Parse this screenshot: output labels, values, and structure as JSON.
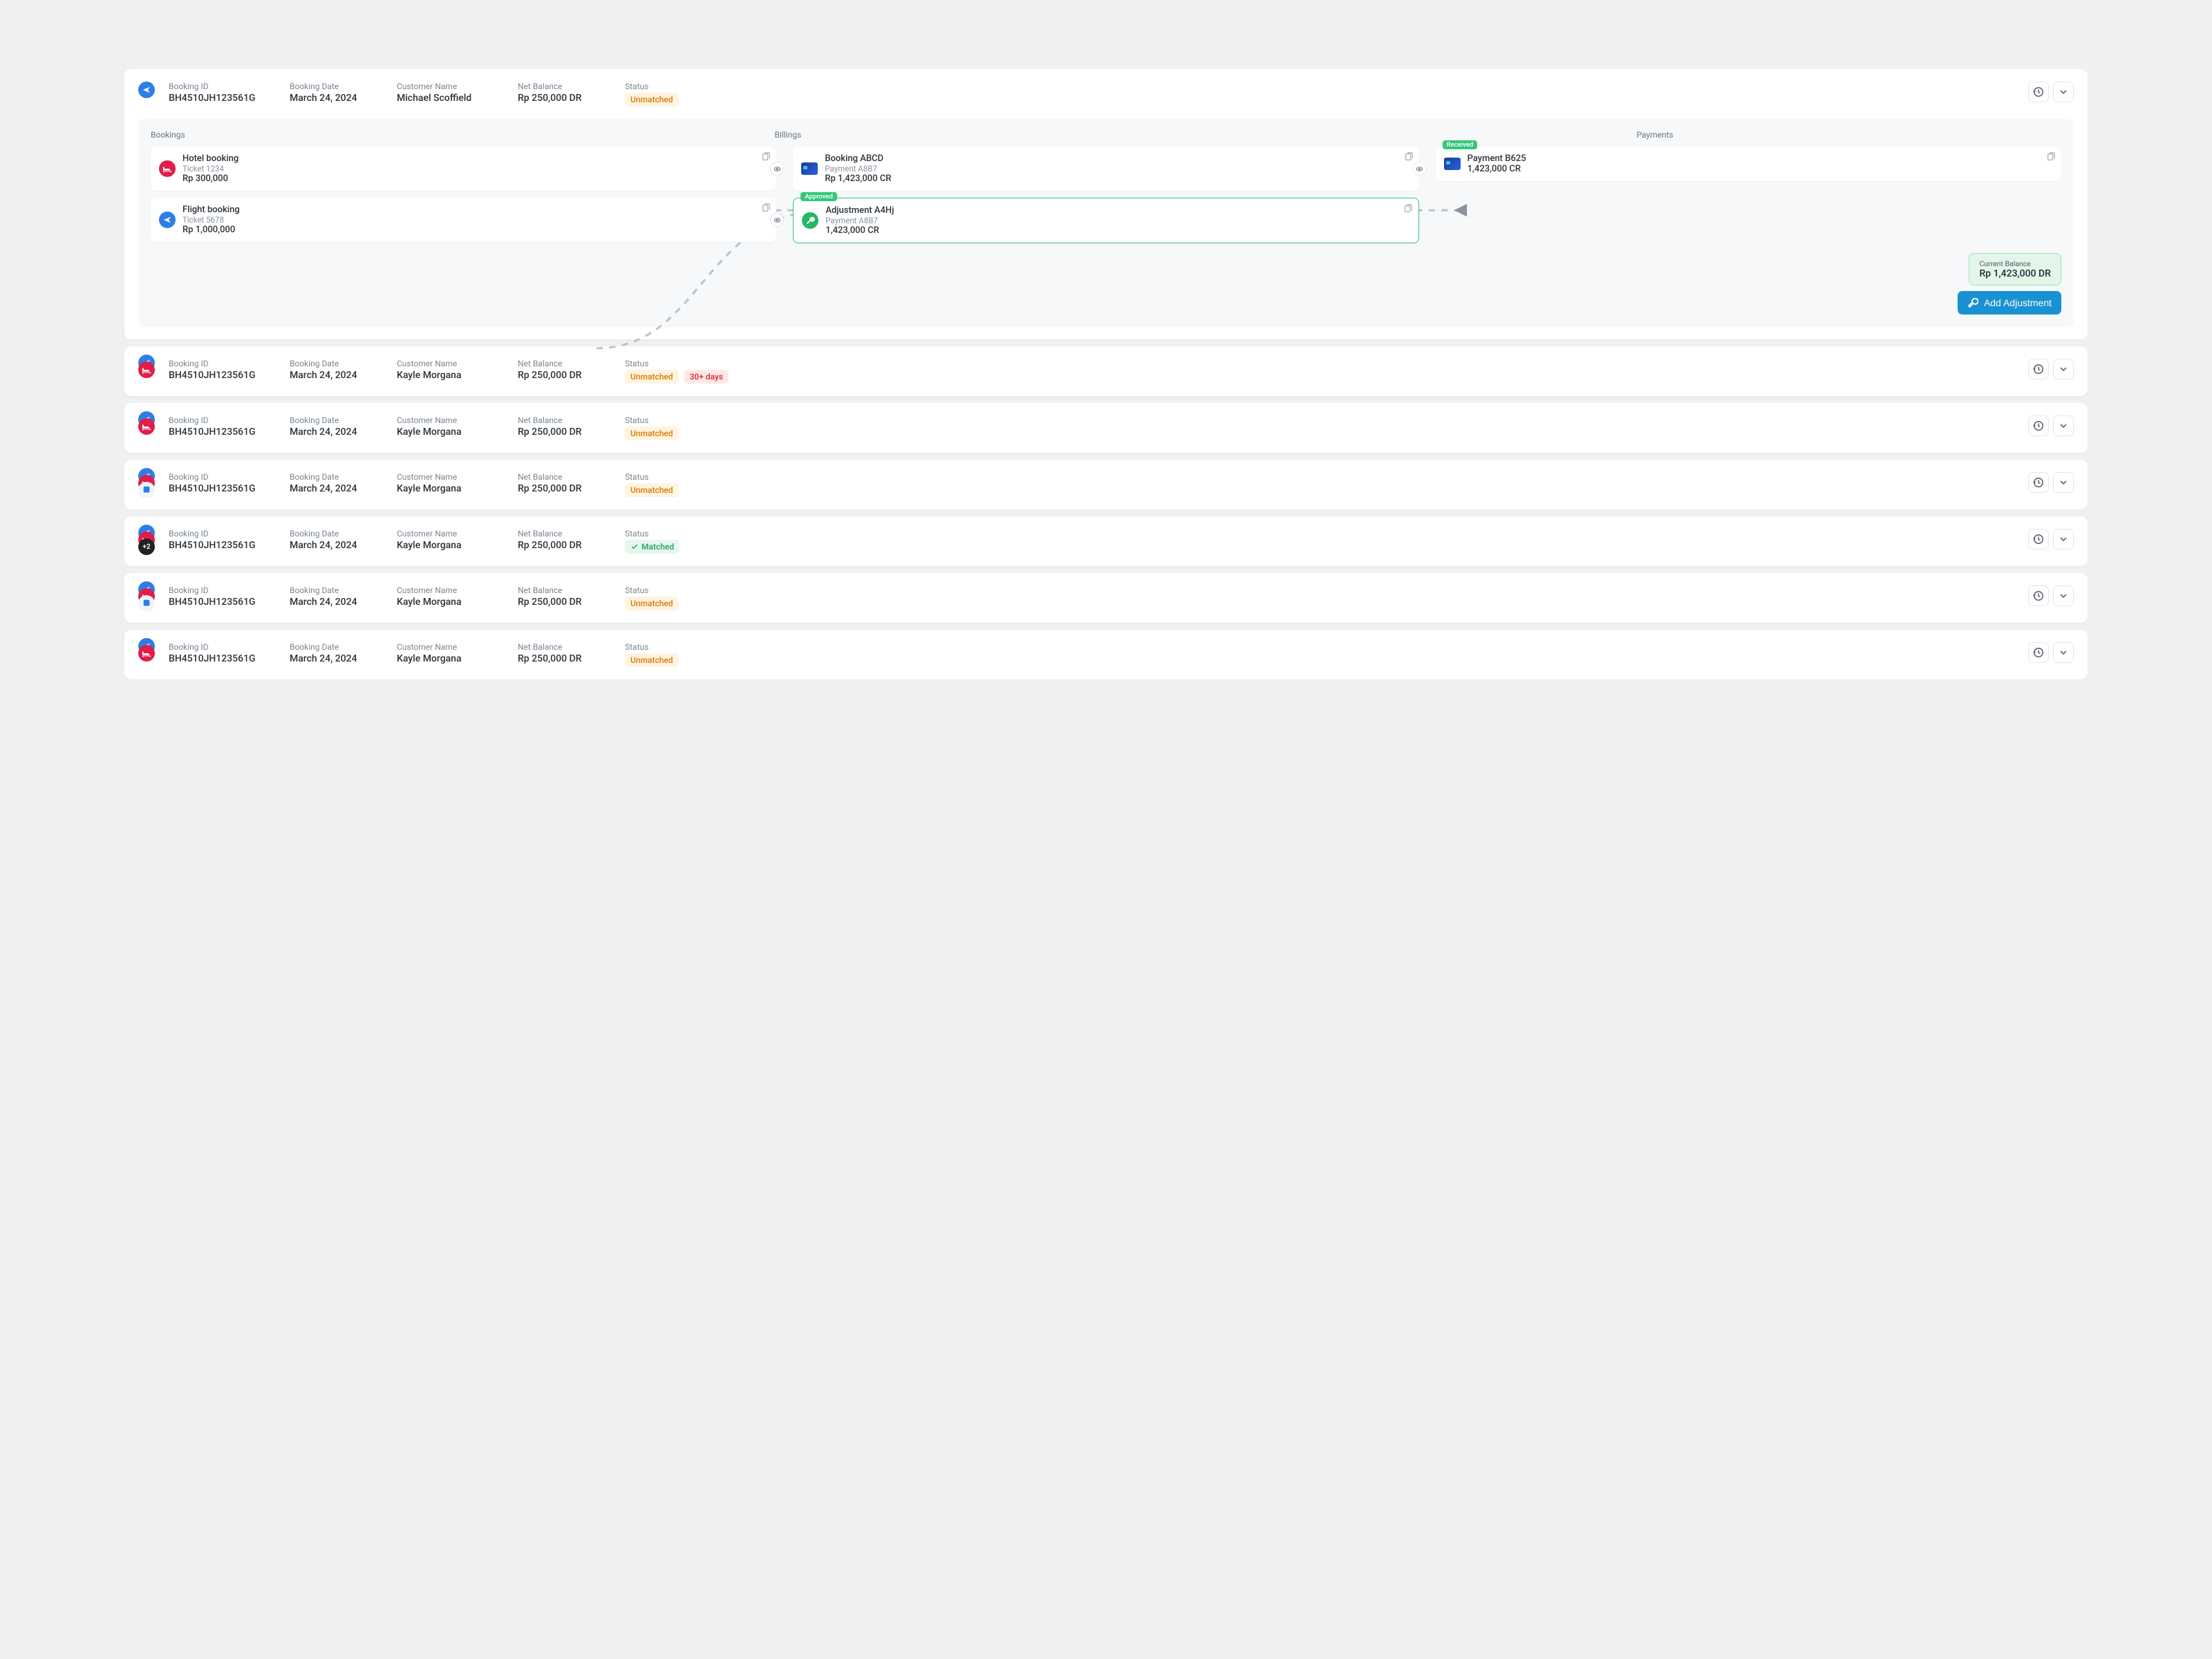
{
  "labels": {
    "bookingId": "Booking ID",
    "bookingDate": "Booking Date",
    "customer": "Customer Name",
    "netBalance": "Net Balance",
    "status": "Status"
  },
  "statuses": {
    "unmatched": "Unmatched",
    "matched": "Matched",
    "overdue": "30+ days"
  },
  "workflow": {
    "headers": {
      "bookings": "Bookings",
      "billings": "Billings",
      "payments": "Payments"
    },
    "bookings": [
      {
        "title": "Hotel booking",
        "sub": "Ticket 1234",
        "val": "Rp 300,000"
      },
      {
        "title": "Flight booking",
        "sub": "Ticket 5678",
        "val": "Rp 1,000,000"
      }
    ],
    "billings": [
      {
        "title": "Booking ABCD",
        "sub": "Payment A8B7",
        "val": "Rp 1,423,000 CR"
      },
      {
        "title": "Adjustment A4Hj",
        "sub": "Payment A8B7",
        "val": "1,423,000 CR",
        "badge": "Approved"
      }
    ],
    "payments": [
      {
        "title": "Payment B625",
        "val": "1,423,000 CR",
        "badge": "Received"
      }
    ],
    "balance": {
      "label": "Current Balance",
      "value": "Rp 1,423,000 DR"
    },
    "addAdjustment": "Add Adjustment"
  },
  "rows": [
    {
      "id": "BH4510JH123561G",
      "date": "March 24, 2024",
      "name": "Michael Scoffield",
      "bal": "Rp 250,000 DR",
      "status": "unmatched",
      "icons": [
        "flight"
      ],
      "expanded": true
    },
    {
      "id": "BH4510JH123561G",
      "date": "March 24, 2024",
      "name": "Kayle Morgana",
      "bal": "Rp 250,000 DR",
      "status": "unmatched",
      "overdue": true,
      "icons": [
        "flight",
        "hotel"
      ]
    },
    {
      "id": "BH4510JH123561G",
      "date": "March 24, 2024",
      "name": "Kayle Morgana",
      "bal": "Rp 250,000 DR",
      "status": "unmatched",
      "icons": [
        "flight",
        "hotel"
      ]
    },
    {
      "id": "BH4510JH123561G",
      "date": "March 24, 2024",
      "name": "Kayle Morgana",
      "bal": "Rp 250,000 DR",
      "status": "unmatched",
      "icons": [
        "flight",
        "hotel",
        "train"
      ]
    },
    {
      "id": "BH4510JH123561G",
      "date": "March 24, 2024",
      "name": "Kayle Morgana",
      "bal": "Rp 250,000 DR",
      "status": "matched",
      "icons": [
        "flight",
        "hotel",
        "more"
      ],
      "more": "+2"
    },
    {
      "id": "BH4510JH123561G",
      "date": "March 24, 2024",
      "name": "Kayle Morgana",
      "bal": "Rp 250,000 DR",
      "status": "unmatched",
      "icons": [
        "flight",
        "hotel",
        "train"
      ]
    },
    {
      "id": "BH4510JH123561G",
      "date": "March 24, 2024",
      "name": "Kayle Morgana",
      "bal": "Rp 250,000 DR",
      "status": "unmatched",
      "icons": [
        "flight",
        "hotel"
      ]
    }
  ]
}
